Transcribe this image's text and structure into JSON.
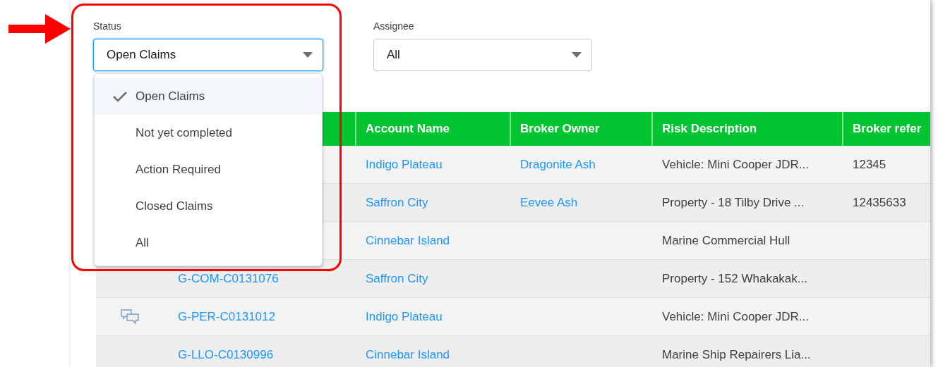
{
  "filters": [
    {
      "label": "Status",
      "value": "Open Claims",
      "open": true
    },
    {
      "label": "Assignee",
      "value": "All",
      "open": false
    }
  ],
  "status_options": [
    {
      "label": "Open Claims",
      "selected": true
    },
    {
      "label": "Not yet completed",
      "selected": false
    },
    {
      "label": "Action Required",
      "selected": false
    },
    {
      "label": "Closed Claims",
      "selected": false
    },
    {
      "label": "All",
      "selected": false
    }
  ],
  "table": {
    "columns": [
      "Account Name",
      "Broker Owner",
      "Risk Description",
      "Broker refer"
    ],
    "rows": [
      {
        "account": "Indigo Plateau",
        "broker_owner": "Dragonite Ash",
        "risk": "Vehicle: Mini Cooper JDR...",
        "broker_ref": "12345"
      },
      {
        "account": "Saffron City",
        "broker_owner": "Eevee Ash",
        "risk": "Property - 18 Tilby Drive ...",
        "broker_ref": "12435633"
      },
      {
        "account": "Cinnebar Island",
        "risk": "Marine Commercial Hull"
      },
      {
        "claim": "G-COM-C0131076",
        "account": "Saffron City",
        "risk": "Property - 152 Whakakak..."
      },
      {
        "comments": true,
        "claim": "G-PER-C0131012",
        "account": "Indigo Plateau",
        "risk": "Vehicle: Mini Cooper JDR..."
      },
      {
        "claim": "G-LLO-C0130996",
        "account": "Cinnebar Island",
        "risk": "Marine Ship Repairers Lia..."
      }
    ]
  }
}
